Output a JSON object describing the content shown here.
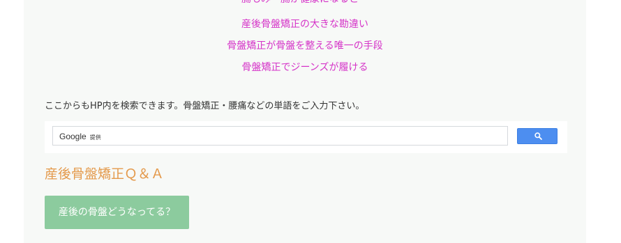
{
  "links": [
    {
      "label": "腸もみ～腸が健康になると～"
    },
    {
      "label": "産後骨盤矯正の大きな勘違い"
    },
    {
      "label": "骨盤矯正が骨盤を整える唯一の手段"
    },
    {
      "label": "骨盤矯正でジーンズが履ける"
    }
  ],
  "search": {
    "note": "ここからもHP内を検索できます。骨盤矯正・腰痛などの単語をご入力下さい。",
    "brand": "Google",
    "provided_by": "提供",
    "button_icon": "search-icon"
  },
  "qa": {
    "heading": "産後骨盤矯正Ｑ＆Ａ",
    "button_label": "産後の骨盤どうなってる？"
  },
  "colors": {
    "link": "#d534c8",
    "heading": "#e49a4c",
    "qa_button": "#8ccb9e",
    "search_button": "#4d8ef0",
    "panel": "#f7f9f7"
  }
}
